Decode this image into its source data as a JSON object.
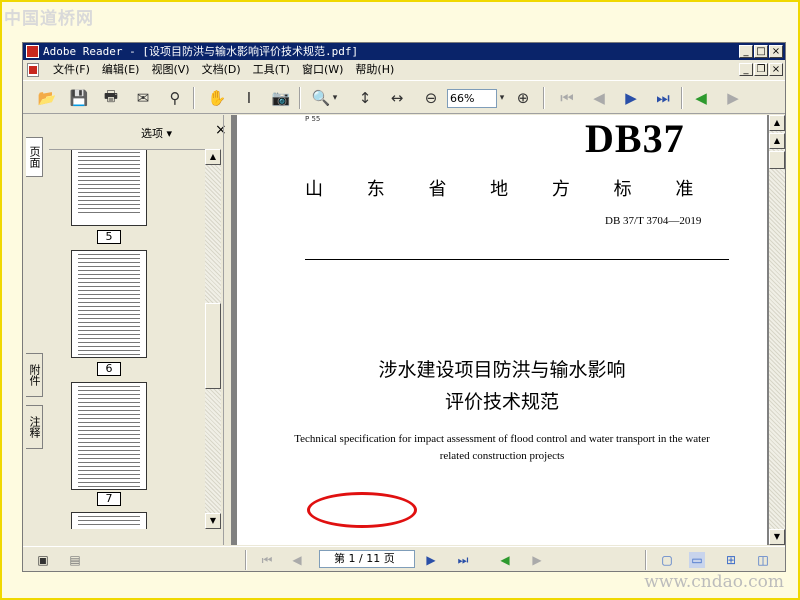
{
  "watermark_top": "中国道桥网",
  "watermark_bottom": "www.cndao.com",
  "window": {
    "title": "Adobe Reader - [设项目防洪与输水影响评价技术规范.pdf]"
  },
  "menus": [
    {
      "label": "文件(F)"
    },
    {
      "label": "编辑(E)"
    },
    {
      "label": "视图(V)"
    },
    {
      "label": "文档(D)"
    },
    {
      "label": "工具(T)"
    },
    {
      "label": "窗口(W)"
    },
    {
      "label": "帮助(H)"
    }
  ],
  "toolbar": {
    "zoom_value": "66%"
  },
  "panel": {
    "tabs": [
      "页面",
      "附件",
      "注释"
    ],
    "options_label": "选项",
    "close_label": "×",
    "thumbnails": [
      {
        "label": "5"
      },
      {
        "label": "6"
      },
      {
        "label": "7"
      }
    ]
  },
  "document": {
    "corner_text": "P 55",
    "logo": "DB37",
    "province_standard": "山 东 省 地 方 标 准",
    "standard_number": "DB 37/T 3704—2019",
    "title_cn_line1": "涉水建设项目防洪与输水影响",
    "title_cn_line2": "评价技术规范",
    "title_en": "Technical specification for impact assessment of flood control and water transport in the water related construction projects"
  },
  "status": {
    "page_indicator": "第 1 / 11 页"
  },
  "colors": {
    "titlebar": "#0a246a",
    "chrome": "#ece9d8",
    "highlight_oval": "#e01010",
    "frame_border": "#f0d800"
  }
}
